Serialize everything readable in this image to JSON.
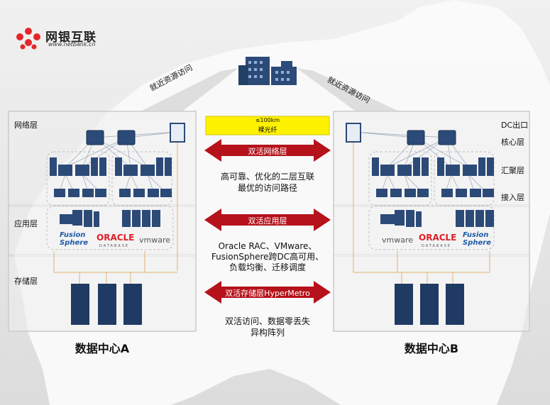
{
  "brand": {
    "name_cn": "网银互联",
    "url": "www.netbank.cn",
    "logo_color": "#e4262a"
  },
  "access_label_left": "就近资源访问",
  "access_label_right": "就近资源访问",
  "fiber_box": {
    "distance": "≤100km",
    "type": "裸光纤",
    "color": "#fff200"
  },
  "arrows": [
    {
      "label": "双活网络层",
      "desc": [
        "高可靠、优化的二层互联",
        "最优的访问路径"
      ]
    },
    {
      "label": "双活应用层",
      "desc": [
        "Oracle RAC、VMware、",
        "FusionSphere跨DC高可用、",
        "负载均衡、迁移调度"
      ]
    },
    {
      "label": "双活存储层HyperMetro",
      "desc": [
        "双活访问、数据零丢失",
        "异构阵列"
      ]
    }
  ],
  "arrow_color": "#b5121b",
  "dc_a": {
    "title": "数据中心A",
    "layers": [
      "网络层",
      "应用层",
      "存储层"
    ],
    "products": {
      "fusion": [
        "Fusion",
        "Sphere"
      ],
      "oracle": "ORACLE",
      "oracle_sub": "DATABASE",
      "vmware": "vmware"
    }
  },
  "dc_b": {
    "title": "数据中心B",
    "layers": [
      "DC出口",
      "核心层",
      "汇聚层",
      "接入层"
    ],
    "products": {
      "fusion": [
        "Fusion",
        "Sphere"
      ],
      "oracle": "ORACLE",
      "oracle_sub": "DATABASE",
      "vmware": "vmware"
    }
  },
  "colors": {
    "map": "#f8f8f8",
    "panel_border": "#c8c8c8",
    "device": "#2c4a77",
    "fusion_blue": "#1f5aa6",
    "oracle_red": "#e01e26",
    "link": "#e0b070"
  }
}
